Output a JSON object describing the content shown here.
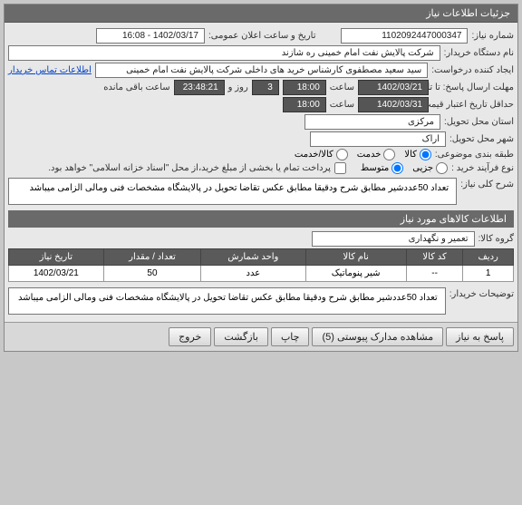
{
  "panel": {
    "title": "جزئیات اطلاعات نیاز"
  },
  "fields": {
    "reqNoLabel": "شماره نیاز:",
    "reqNo": "1102092447000347",
    "announceLabel": "تاریخ و ساعت اعلان عمومی:",
    "announce": "1402/03/17 - 16:08",
    "buyerOrgLabel": "نام دستگاه خریدار:",
    "buyerOrg": "شرکت پالایش نفت امام خمینی  ره  شازند",
    "creatorLabel": "ایجاد کننده درخواست:",
    "creator": "سید سعید مصطفوی کارشناس خرید های داخلی شرکت پالایش نفت امام خمینی",
    "contactLink": "اطلاعات تماس خریدار",
    "deadlineLabel": "مهلت ارسال پاسخ: تا تاریخ:",
    "deadlineDate": "1402/03/21",
    "timeLabel": "ساعت",
    "deadlineTime": "18:00",
    "dayLabel": "روز و",
    "dayCount": "3",
    "remainTime": "23:48:21",
    "remainText": "ساعت باقی مانده",
    "priceValidLabel": "حداقل تاریخ اعتبار قیمت: تا تاریخ:",
    "priceValidDate": "1402/03/31",
    "priceValidTime": "18:00",
    "deliveryProvLabel": "استان محل تحویل:",
    "deliveryProv": "مرکزی",
    "deliveryCityLabel": "شهر محل تحویل:",
    "deliveryCity": "اراک",
    "categoryLabel": "طبقه بندی موضوعی:",
    "procTypeLabel": "نوع فرآیند خرید :",
    "payNote": "پرداخت تمام یا بخشی از مبلغ خرید،از محل \"اسناد خزانه اسلامی\" خواهد بود.",
    "descLabel": "شرح کلی نیاز:",
    "desc": "تعداد 50عددشیر مطابق شرح ودقیقا مطابق عکس تقاضا تحویل در پالایشگاه مشخصات فنی ومالی الزامی میباشد",
    "goodsSection": "اطلاعات کالاهای مورد نیاز",
    "goodsGroupLabel": "گروه کالا:",
    "goodsGroup": "تعمیر و نگهداری",
    "buyerDescLabel": "توضیحات خریدار:",
    "buyerDesc": "تعداد 50عددشیر مطابق شرح ودقیقا مطابق عکس تقاضا تحویل در پالایشگاه مشخصات فنی ومالی الزامی میباشد"
  },
  "radios": {
    "cat": {
      "goods": "کالا",
      "service": "خدمت",
      "goodsService": "کالا/خدمت"
    },
    "proc": {
      "small": "جزیی",
      "medium": "متوسط"
    }
  },
  "table": {
    "headers": [
      "ردیف",
      "کد کالا",
      "نام کالا",
      "واحد شمارش",
      "تعداد / مقدار",
      "تاریخ نیاز"
    ],
    "rows": [
      {
        "row": "1",
        "code": "--",
        "name": "شیر پنوماتیک",
        "unit": "عدد",
        "qty": "50",
        "date": "1402/03/21"
      }
    ]
  },
  "buttons": {
    "respond": "پاسخ به نیاز",
    "attachments": "مشاهده مدارک پیوستی (5)",
    "print": "چاپ",
    "back": "بازگشت",
    "exit": "خروج"
  }
}
